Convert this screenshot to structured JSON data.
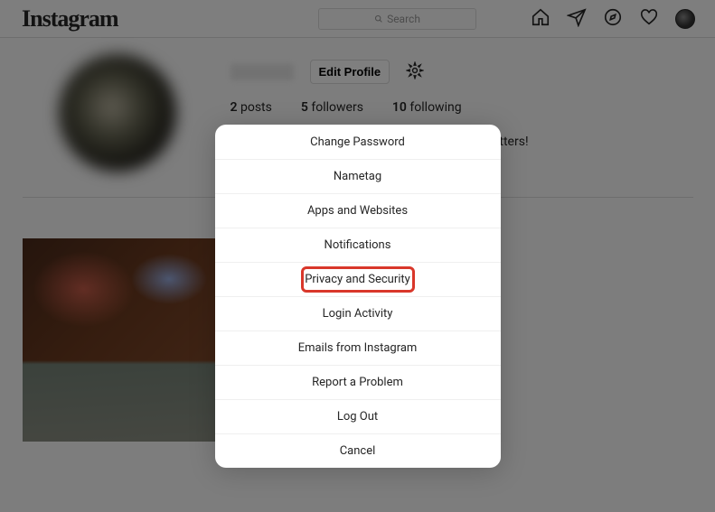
{
  "header": {
    "logo_text": "Instagram",
    "search_placeholder": "Search"
  },
  "profile": {
    "edit_profile_label": "Edit Profile",
    "stats": {
      "posts_count": "2",
      "posts_label": "posts",
      "followers_count": "5",
      "followers_label": "followers",
      "following_count": "10",
      "following_label": "following"
    },
    "bio_fragment": "ryone matters!"
  },
  "modal": {
    "items": [
      "Change Password",
      "Nametag",
      "Apps and Websites",
      "Notifications",
      "Privacy and Security",
      "Login Activity",
      "Emails from Instagram",
      "Report a Problem",
      "Log Out",
      "Cancel"
    ],
    "highlighted_index": 4
  },
  "colors": {
    "highlight": "#d9372a",
    "border": "#dbdbdb",
    "text": "#262626"
  }
}
